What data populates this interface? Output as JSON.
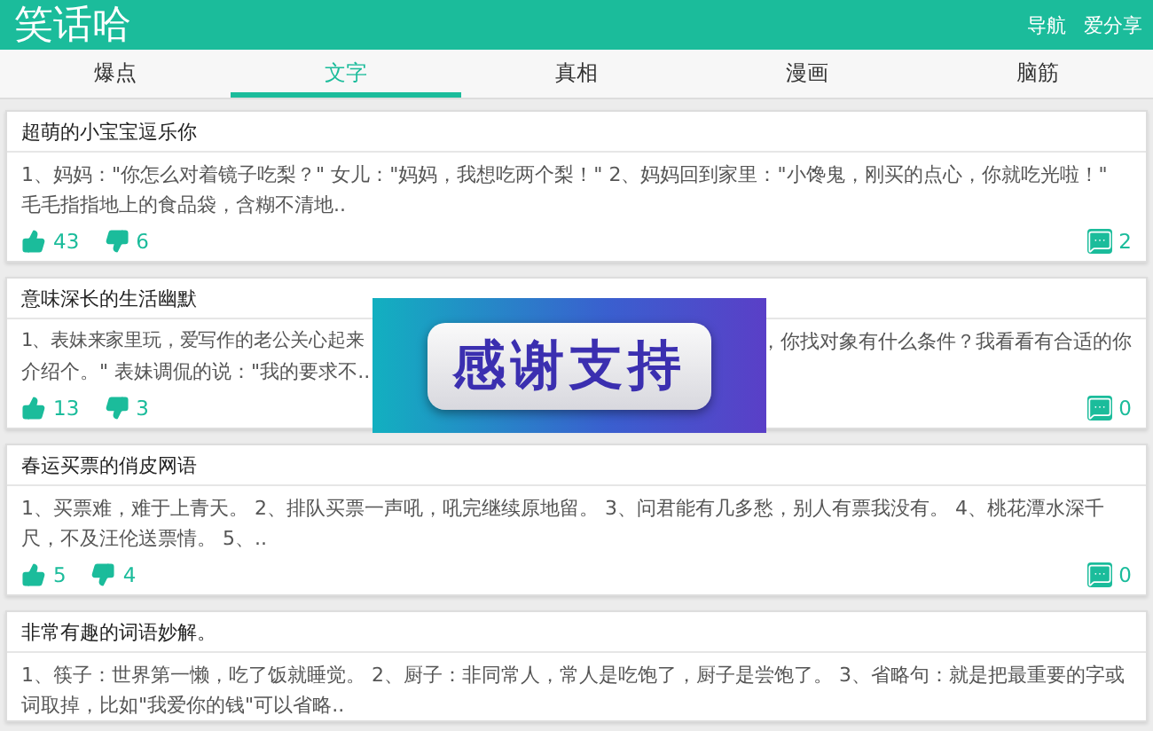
{
  "header": {
    "logo": "笑话哈",
    "links": [
      "导航",
      "爱分享"
    ]
  },
  "tabs": [
    {
      "label": "爆点",
      "selected": false
    },
    {
      "label": "文字",
      "selected": true
    },
    {
      "label": "真相",
      "selected": false
    },
    {
      "label": "漫画",
      "selected": false
    },
    {
      "label": "脑筋",
      "selected": false
    }
  ],
  "posts": [
    {
      "title": "超萌的小宝宝逗乐你",
      "body": [
        "1、妈妈：\"你怎么对着镜子吃梨？\" 女儿：\"妈妈，我想吃两个梨！\" 2、妈妈回到家里：\"小馋鬼，刚买的点心，你就吃光啦！\" 毛毛指指地上的食品袋，含糊不清地.."
      ],
      "likes": "43",
      "dislikes": "6",
      "comments": "2"
    },
    {
      "title": "意味深长的生活幽默",
      "body_split": {
        "left": "1、表妹来家里玩，爱写作的老公关心起来",
        "right": "，你找对象有什么条件？我看看有合适的你",
        "rest": "介绍个。\" 表妹调侃的说：\"我的要求不.."
      },
      "likes": "13",
      "dislikes": "3",
      "comments": "0"
    },
    {
      "title": "春运买票的俏皮网语",
      "body": [
        "1、买票难，难于上青天。 2、排队买票一声吼，吼完继续原地留。 3、问君能有几多愁，别人有票我没有。 4、桃花潭水深千尺，不及汪伦送票情。 5、.."
      ],
      "likes": "5",
      "dislikes": "4",
      "comments": "0"
    },
    {
      "title": "非常有趣的词语妙解。",
      "body": [
        "1、筷子：世界第一懒，吃了饭就睡觉。 2、厨子：非同常人，常人是吃饱了，厨子是尝饱了。 3、省略句：就是把最重要的字或词取掉，比如\"我爱你的钱\"可以省略.."
      ]
    }
  ],
  "overlay": {
    "label": "感谢支持"
  }
}
